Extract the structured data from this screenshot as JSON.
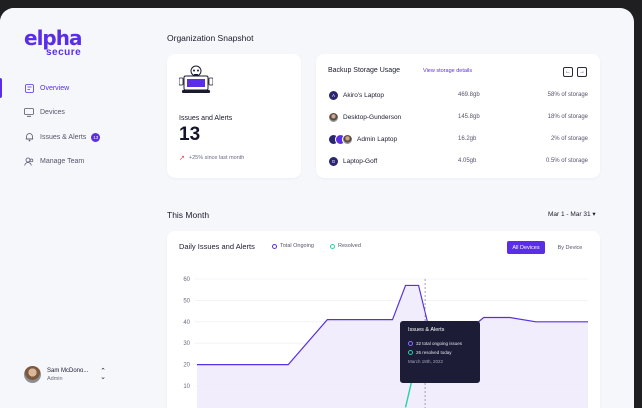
{
  "brand": {
    "logo_main": "elpha",
    "logo_sub": "secure"
  },
  "sidebar": {
    "items": [
      {
        "label": "Overview",
        "icon": "overview-icon",
        "active": true
      },
      {
        "label": "Devices",
        "icon": "devices-icon"
      },
      {
        "label": "Issues & Alerts",
        "icon": "bell-icon",
        "badge": "13"
      },
      {
        "label": "Manage Team",
        "icon": "team-icon"
      }
    ]
  },
  "user": {
    "name": "Sam McDono...",
    "role": "Admin"
  },
  "snapshot": {
    "title": "Organization Snapshot",
    "issues": {
      "label": "Issues and Alerts",
      "count": "13",
      "delta": "+25% since last month"
    },
    "backup": {
      "title": "Backup Storage Usage",
      "link": "View storage details",
      "rows": [
        {
          "initial": "A",
          "name": "Akiro's Laptop",
          "size": "469.8gb",
          "pct": "58% of storage"
        },
        {
          "initial": "",
          "name": "Desktop-Gunderson",
          "size": "145.8gb",
          "pct": "18% of storage"
        },
        {
          "initial": "",
          "name": "Admin Laptop",
          "size": "16.2gb",
          "pct": "2% of storage"
        },
        {
          "initial": "G",
          "name": "Laptop-Goff",
          "size": "4.05gb",
          "pct": "0.5% of storage"
        }
      ]
    }
  },
  "month": {
    "title": "This Month",
    "range": "Mar 1 - Mar 31 ▾"
  },
  "chart": {
    "title": "Daily Issues and Alerts",
    "legend_total": "Total Ongoing",
    "legend_resolved": "Resolved",
    "btn_all": "All Devices",
    "btn_by": "By Device",
    "tooltip": {
      "title": "Issues & Alerts",
      "line1": "32 total ongoing issues",
      "line2": "26 resolved today",
      "date": "March 18th, 2022"
    }
  },
  "colors": {
    "accent": "#5a2ee6",
    "resolved": "#22d3a6",
    "tooltip_bg": "#1c1c36"
  },
  "chart_data": {
    "type": "line",
    "title": "Daily Issues and Alerts",
    "ylim": [
      0,
      60
    ],
    "yticks": [
      "60",
      "50",
      "40",
      "30",
      "20",
      "10"
    ],
    "series": [
      {
        "name": "Total Ongoing",
        "x": [
          1,
          5,
          8,
          11,
          12,
          14,
          16,
          17,
          18,
          19,
          21,
          23,
          24,
          25,
          27,
          31
        ],
        "y": [
          20,
          20,
          20,
          41,
          41,
          41,
          41,
          57,
          57,
          32,
          32,
          42,
          42,
          42,
          40,
          40
        ]
      },
      {
        "name": "Resolved",
        "x": [
          17,
          18,
          18.5
        ],
        "y": [
          0,
          26,
          30
        ]
      }
    ]
  }
}
